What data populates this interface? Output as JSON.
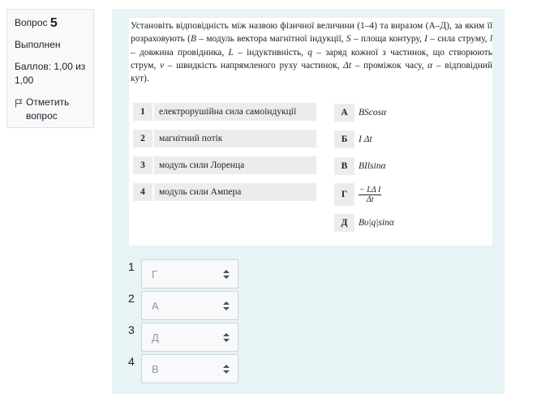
{
  "info": {
    "question_word": "Вопрос",
    "question_number": "5",
    "state": "Выполнен",
    "grade": "Баллов: 1,00 из 1,00",
    "flag_label": "Отметить вопрос",
    "flag_icon": "flag-icon"
  },
  "question": {
    "prompt_segments": [
      {
        "t": "Установіть відповідність між назвою фізичної величини (1–4) та виразом (А–Д), за яким її розраховують ("
      },
      {
        "t": "B",
        "i": true
      },
      {
        "t": " – модуль вектора магнітної індукції, "
      },
      {
        "t": "S",
        "i": true
      },
      {
        "t": " – площа контуру, "
      },
      {
        "t": "I",
        "i": true
      },
      {
        "t": " – сила струму, "
      },
      {
        "t": "l",
        "i": true
      },
      {
        "t": " – довжина провідника, "
      },
      {
        "t": "L",
        "i": true
      },
      {
        "t": " – індуктивність, "
      },
      {
        "t": "q",
        "i": true
      },
      {
        "t": " – заряд кожної з частинок, що створюють струм, "
      },
      {
        "t": "v",
        "i": true
      },
      {
        "t": " – швидкість напрямленого руху частинок, "
      },
      {
        "t": "Δt",
        "i": true
      },
      {
        "t": " – проміжок часу, "
      },
      {
        "t": "α",
        "i": true
      },
      {
        "t": " – відповідний кут)."
      }
    ],
    "left_items": [
      {
        "num": "1",
        "text": "електрорушійна сила самоіндукції"
      },
      {
        "num": "2",
        "text": "магнітний потік"
      },
      {
        "num": "3",
        "text": "модуль сили Лоренца"
      },
      {
        "num": "4",
        "text": "модуль сили Ампера"
      }
    ],
    "right_items": [
      {
        "letter": "А",
        "expr": "BScosα"
      },
      {
        "letter": "Б",
        "expr": "I Δt"
      },
      {
        "letter": "В",
        "expr": "BIlsinα"
      },
      {
        "letter": "Г",
        "expr_num": "− LΔ I",
        "expr_den": "Δt"
      },
      {
        "letter": "Д",
        "expr": "Bυ|q|sinα"
      }
    ]
  },
  "answers": [
    {
      "label": "1",
      "value": "Г"
    },
    {
      "label": "2",
      "value": "А"
    },
    {
      "label": "3",
      "value": "Д"
    },
    {
      "label": "4",
      "value": "В"
    }
  ]
}
